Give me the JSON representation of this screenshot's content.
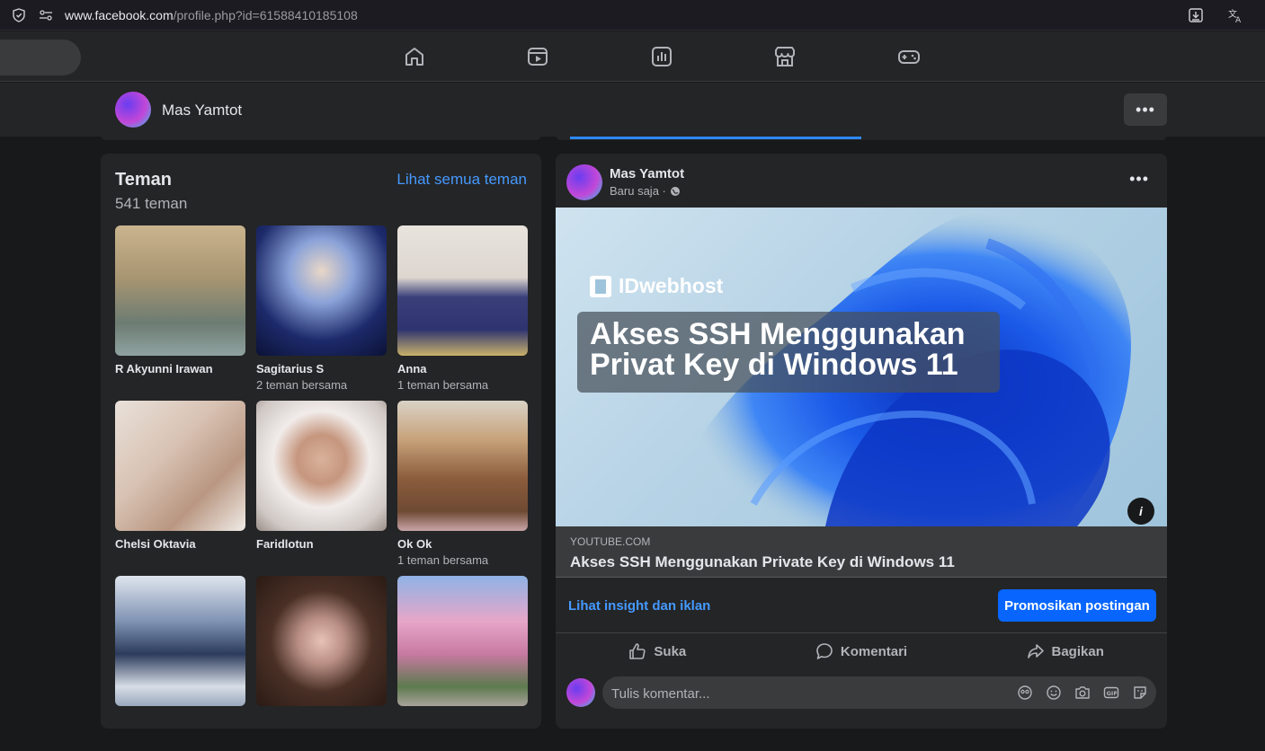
{
  "browser": {
    "url_host": "www.facebook.com",
    "url_path": "/profile.php?id=61588410185108"
  },
  "nav": {
    "icons": [
      "home-icon",
      "video-icon",
      "dashboard-icon",
      "marketplace-icon",
      "gaming-icon"
    ]
  },
  "profile_bar": {
    "name": "Mas Yamtot",
    "more": "•••"
  },
  "friends": {
    "title": "Teman",
    "count": "541 teman",
    "see_all": "Lihat semua teman",
    "items": [
      {
        "name": "R Akyunni Irawan",
        "mutual": ""
      },
      {
        "name": "Sagitarius S",
        "mutual": "2 teman bersama"
      },
      {
        "name": "Anna",
        "mutual": "1 teman bersama"
      },
      {
        "name": "Chelsi Oktavia",
        "mutual": ""
      },
      {
        "name": "Faridlotun",
        "mutual": ""
      },
      {
        "name": "Ok Ok",
        "mutual": "1 teman bersama"
      },
      {
        "name": "",
        "mutual": ""
      },
      {
        "name": "",
        "mutual": ""
      },
      {
        "name": "",
        "mutual": ""
      }
    ]
  },
  "post": {
    "author": "Mas Yamtot",
    "time": "Baru saja ·",
    "more": "•••",
    "thumb_brand": "IDwebhost",
    "thumb_headline_1": "Akses SSH Menggunakan",
    "thumb_headline_2": "Privat Key di Windows 11",
    "info": "i",
    "link_domain": "YOUTUBE.COM",
    "link_title": "Akses SSH Menggunakan Private Key di Windows 11",
    "insight": "Lihat insight dan iklan",
    "promote": "Promosikan postingan",
    "actions": {
      "like": "Suka",
      "comment": "Komentari",
      "share": "Bagikan"
    },
    "comment_placeholder": "Tulis komentar..."
  }
}
